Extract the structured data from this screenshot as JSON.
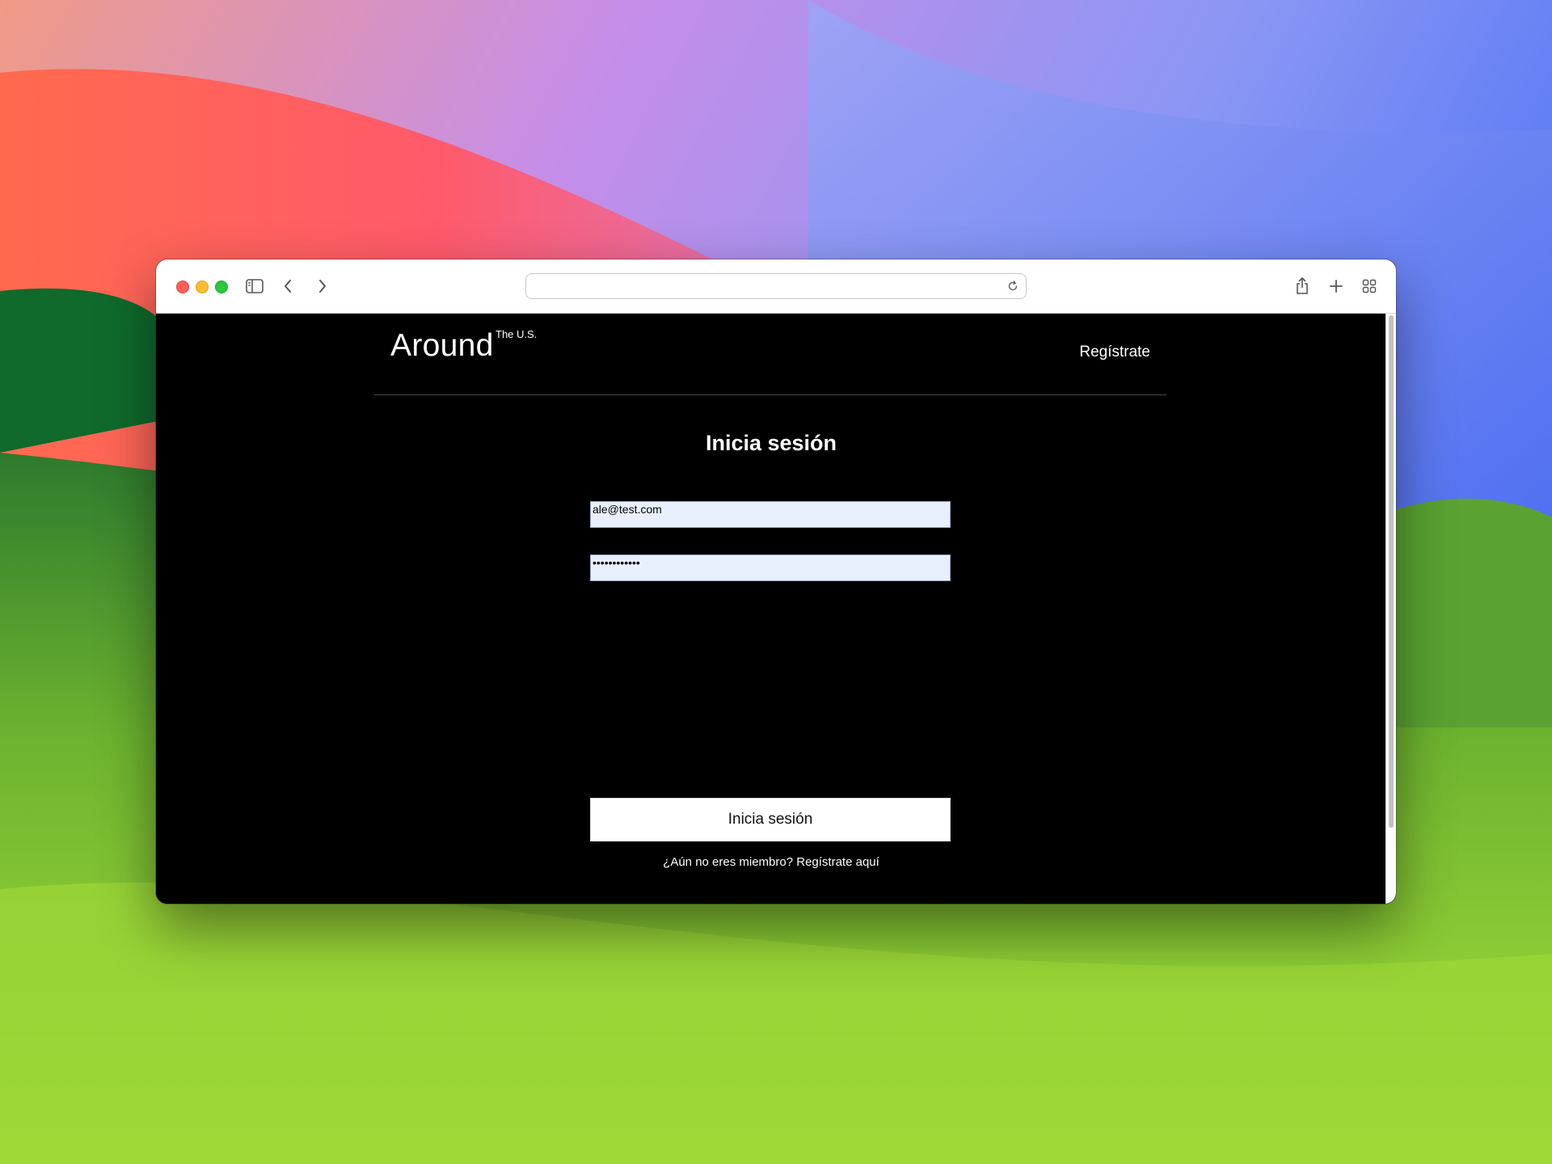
{
  "browser": {
    "address_value": "",
    "icons": {
      "sidebar": "sidebar-icon",
      "back": "chevron-left-icon",
      "forward": "chevron-right-icon",
      "reload": "reload-icon",
      "share": "share-icon",
      "new_tab": "plus-icon",
      "tab_overview": "grid-icon"
    }
  },
  "header": {
    "logo": "Around",
    "logo_superscript": "The U.S.",
    "register_link": "Regístrate"
  },
  "form": {
    "title": "Inicia sesión",
    "email_value": "ale@test.com",
    "password_value": "••••••••••••",
    "submit_label": "Inicia sesión",
    "signup_prompt": "¿Aún no eres miembro? Regístrate aquí"
  },
  "colors": {
    "page_background": "#000000",
    "autofill_background": "#e8f0fe",
    "button_background": "#ffffff"
  }
}
